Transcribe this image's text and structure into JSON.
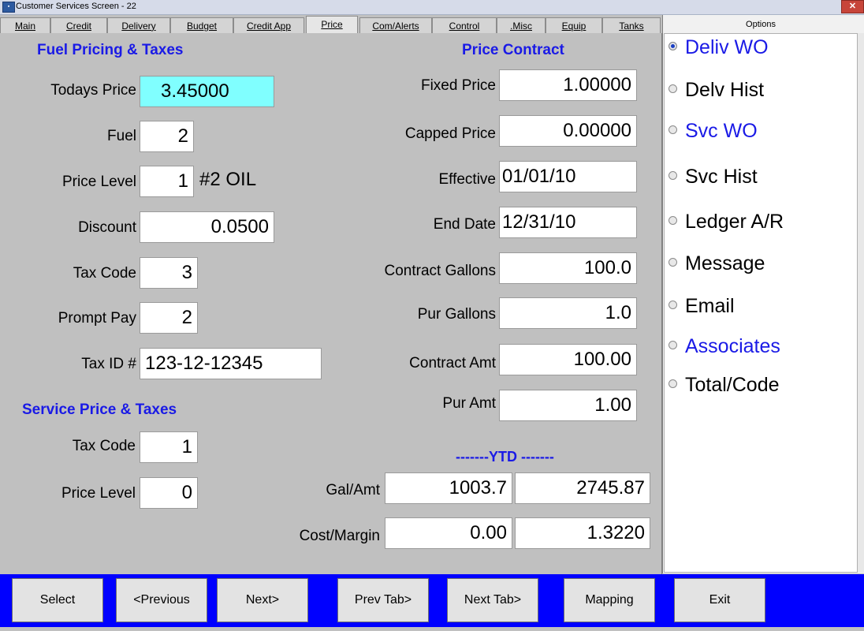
{
  "window": {
    "title": "Customer Services Screen - 22",
    "close_glyph": "✕"
  },
  "tabs": [
    {
      "label": "Main"
    },
    {
      "label": "Credit"
    },
    {
      "label": "Delivery"
    },
    {
      "label": "Budget"
    },
    {
      "label": "Credit App"
    },
    {
      "label": "Price",
      "active": true
    },
    {
      "label": "Com/Alerts"
    },
    {
      "label": "Control"
    },
    {
      "label": ".Misc"
    },
    {
      "label": "Equip"
    },
    {
      "label": "Tanks"
    }
  ],
  "fuel": {
    "title": "Fuel Pricing & Taxes",
    "todays_price_label": "Todays Price",
    "todays_price": "3.45000",
    "fuel_label": "Fuel",
    "fuel": "2",
    "price_level_label": "Price Level",
    "price_level": "1",
    "price_level_desc": "#2 OIL",
    "discount_label": "Discount",
    "discount": "0.0500",
    "tax_code_label": "Tax Code",
    "tax_code": "3",
    "prompt_pay_label": "Prompt Pay",
    "prompt_pay": "2",
    "tax_id_label": "Tax ID #",
    "tax_id": "123-12-12345"
  },
  "service": {
    "title": "Service Price & Taxes",
    "tax_code_label": "Tax Code",
    "tax_code": "1",
    "price_level_label": "Price Level",
    "price_level": "0"
  },
  "contract": {
    "title": "Price Contract",
    "fixed_price_label": "Fixed Price",
    "fixed_price": "1.00000",
    "capped_price_label": "Capped Price",
    "capped_price": "0.00000",
    "effective_label": "Effective",
    "effective": "01/01/10",
    "end_date_label": "End Date",
    "end_date": "12/31/10",
    "contract_gallons_label": "Contract Gallons",
    "contract_gallons": "100.0",
    "pur_gallons_label": "Pur Gallons",
    "pur_gallons": "1.0",
    "contract_amt_label": "Contract Amt",
    "contract_amt": "100.00",
    "pur_amt_label": "Pur Amt",
    "pur_amt": "1.00"
  },
  "ytd": {
    "title": "-------YTD -------",
    "gal_amt_label": "Gal/Amt",
    "gallons": "1003.7",
    "amount": "2745.87",
    "cost_margin_label": "Cost/Margin",
    "cost": "0.00",
    "margin": "1.3220"
  },
  "options": {
    "header": "Options",
    "items": [
      {
        "label": "Deliv WO",
        "selected": true,
        "color": "#1a1ae6"
      },
      {
        "label": "Delv Hist"
      },
      {
        "label": "Svc WO",
        "color": "#1a1ae6"
      },
      {
        "label": "Svc Hist"
      },
      {
        "label": "Ledger A/R"
      },
      {
        "label": "Message"
      },
      {
        "label": "Email"
      },
      {
        "label": "Associates",
        "color": "#1a1ae6"
      },
      {
        "label": "Total/Code"
      }
    ]
  },
  "buttons": {
    "select": "Select",
    "previous": "<Previous",
    "next": "Next>",
    "prev_tab": "Prev Tab>",
    "next_tab": "Next Tab>",
    "mapping": "Mapping",
    "exit": "Exit"
  },
  "colors": {
    "accent_blue": "#1a1ae6",
    "bottom_bar": "#0000ff",
    "highlight_field": "#80ffff"
  }
}
